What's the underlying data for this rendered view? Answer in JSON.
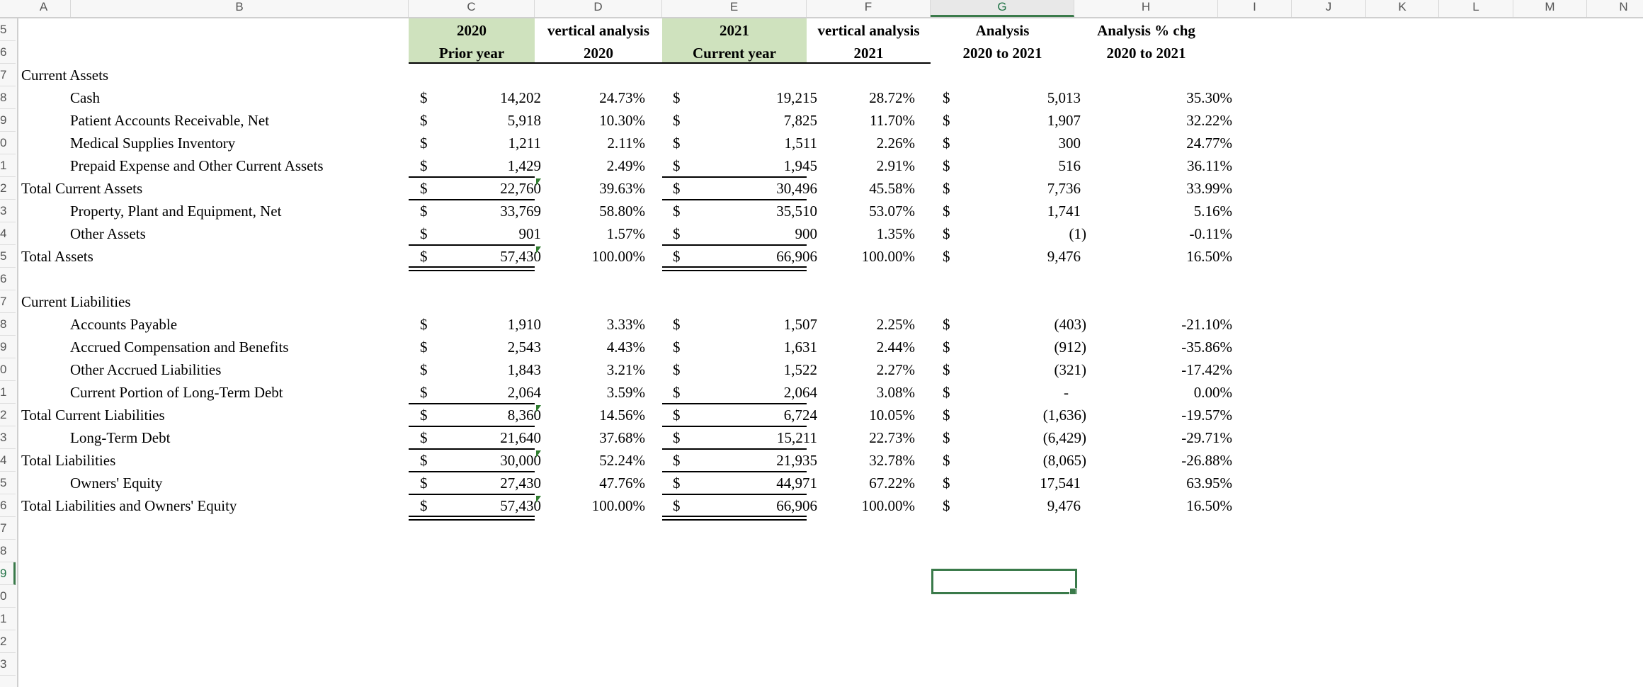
{
  "sheet": {
    "column_letters": [
      "A",
      "B",
      "C",
      "D",
      "E",
      "F",
      "G",
      "H",
      "I",
      "J",
      "K",
      "L",
      "M",
      "N"
    ],
    "selected_column": "G",
    "visible_row_digits": [
      "5",
      "6",
      "7",
      "8",
      "9",
      "0",
      "1",
      "2",
      "3",
      "4",
      "5",
      "6",
      "7",
      "8",
      "9",
      "0",
      "1",
      "2",
      "3",
      "4",
      "5",
      "6",
      "7",
      "8",
      "9",
      "0",
      "1",
      "2",
      "3"
    ],
    "selected_row_index": 24,
    "accent_color": "#217346",
    "header_fill_color": "#cfe2be"
  },
  "headers": {
    "c": {
      "line1": "2020",
      "line2": "Prior year"
    },
    "d": {
      "line1": "vertical analysis",
      "line2": "2020"
    },
    "e": {
      "line1": "2021",
      "line2": "Current year"
    },
    "f": {
      "line1": "vertical analysis",
      "line2": "2021"
    },
    "g": {
      "line1": "Analysis",
      "line2": "2020 to 2021"
    },
    "h": {
      "line1": "Analysis % chg",
      "line2": "2020 to 2021"
    }
  },
  "currency_symbol": "$",
  "rows": [
    {
      "label": "Current Assets",
      "indent": false,
      "heading": true
    },
    {
      "label": "Cash",
      "indent": true,
      "c": "14,202",
      "d": "24.73%",
      "e": "19,215",
      "f": "28.72%",
      "g": "5,013",
      "h": "35.30%"
    },
    {
      "label": "Patient Accounts Receivable, Net",
      "indent": true,
      "c": "5,918",
      "d": "10.30%",
      "e": "7,825",
      "f": "11.70%",
      "g": "1,907",
      "h": "32.22%"
    },
    {
      "label": "Medical Supplies Inventory",
      "indent": true,
      "c": "1,211",
      "d": "2.11%",
      "e": "1,511",
      "f": "2.26%",
      "g": "300",
      "h": "24.77%"
    },
    {
      "label": "Prepaid Expense and Other Current Assets",
      "indent": true,
      "c": "1,429",
      "d": "2.49%",
      "e": "1,945",
      "f": "2.91%",
      "g": "516",
      "h": "36.11%",
      "under": "single"
    },
    {
      "label": "Total Current Assets",
      "indent": false,
      "c": "22,760",
      "d": "39.63%",
      "e": "30,496",
      "f": "45.58%",
      "g": "7,736",
      "h": "33.99%",
      "under": "single",
      "flag": true
    },
    {
      "label": "Property, Plant and Equipment, Net",
      "indent": true,
      "c": "33,769",
      "d": "58.80%",
      "e": "35,510",
      "f": "53.07%",
      "g": "1,741",
      "h": "5.16%"
    },
    {
      "label": "Other Assets",
      "indent": true,
      "c": "901",
      "d": "1.57%",
      "e": "900",
      "f": "1.35%",
      "g": "(1)",
      "h": "-0.11%",
      "under": "single"
    },
    {
      "label": "Total Assets",
      "indent": false,
      "c": "57,430",
      "d": "100.00%",
      "e": "66,906",
      "f": "100.00%",
      "g": "9,476",
      "h": "16.50%",
      "under": "double",
      "flag": true
    },
    {
      "label": "",
      "blank": true
    },
    {
      "label": "Current Liabilities",
      "indent": false,
      "heading": true
    },
    {
      "label": "Accounts Payable",
      "indent": true,
      "c": "1,910",
      "d": "3.33%",
      "e": "1,507",
      "f": "2.25%",
      "g": "(403)",
      "h": "-21.10%"
    },
    {
      "label": "Accrued Compensation and Benefits",
      "indent": true,
      "c": "2,543",
      "d": "4.43%",
      "e": "1,631",
      "f": "2.44%",
      "g": "(912)",
      "h": "-35.86%"
    },
    {
      "label": "Other Accrued Liabilities",
      "indent": true,
      "c": "1,843",
      "d": "3.21%",
      "e": "1,522",
      "f": "2.27%",
      "g": "(321)",
      "h": "-17.42%"
    },
    {
      "label": "Current Portion of Long-Term Debt",
      "indent": true,
      "c": "2,064",
      "d": "3.59%",
      "e": "2,064",
      "f": "3.08%",
      "g": "-",
      "h": "0.00%",
      "under": "single"
    },
    {
      "label": "Total Current Liabilities",
      "indent": false,
      "c": "8,360",
      "d": "14.56%",
      "e": "6,724",
      "f": "10.05%",
      "g": "(1,636)",
      "h": "-19.57%",
      "under": "single",
      "flag": true
    },
    {
      "label": "Long-Term Debt",
      "indent": true,
      "c": "21,640",
      "d": "37.68%",
      "e": "15,211",
      "f": "22.73%",
      "g": "(6,429)",
      "h": "-29.71%",
      "under": "single"
    },
    {
      "label": "Total Liabilities",
      "indent": false,
      "c": "30,000",
      "d": "52.24%",
      "e": "21,935",
      "f": "32.78%",
      "g": "(8,065)",
      "h": "-26.88%",
      "under": "single",
      "flag": true
    },
    {
      "label": "Owners' Equity",
      "indent": true,
      "c": "27,430",
      "d": "47.76%",
      "e": "44,971",
      "f": "67.22%",
      "g": "17,541",
      "h": "63.95%",
      "under": "single"
    },
    {
      "label": "Total Liabilities and Owners' Equity",
      "indent": false,
      "c": "57,430",
      "d": "100.00%",
      "e": "66,906",
      "f": "100.00%",
      "g": "9,476",
      "h": "16.50%",
      "under": "double",
      "flag": true
    }
  ]
}
